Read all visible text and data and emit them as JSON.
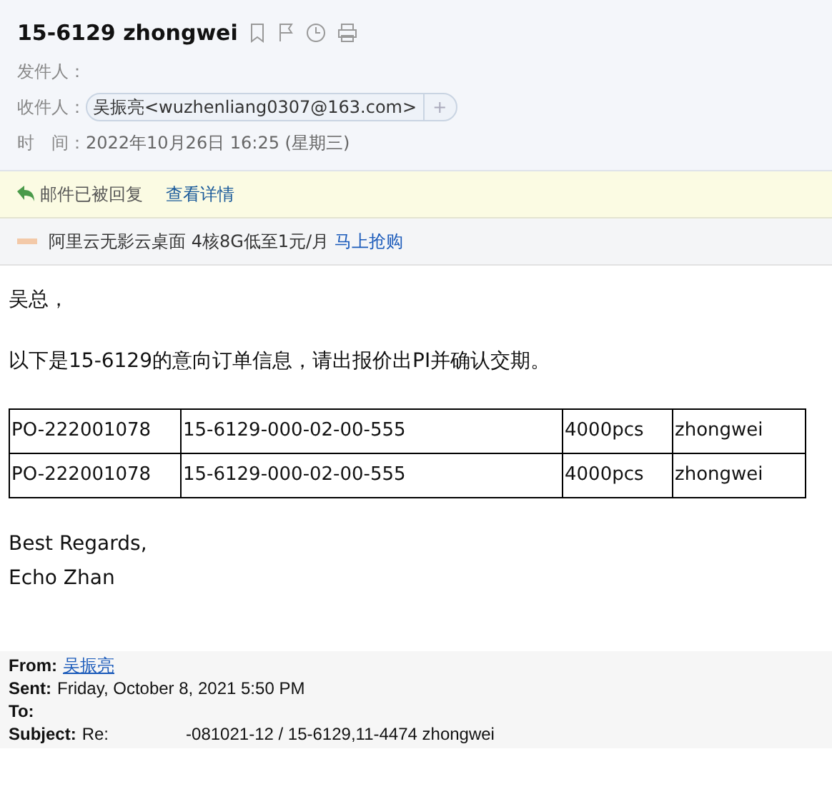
{
  "header": {
    "subject": "15-6129 zhongwei",
    "fields": [
      {
        "label": "发件人：",
        "kind": "text"
      },
      {
        "label": "收件人：",
        "kind": "chip",
        "value": "吴振亮<wuzhenliang0307@163.com>",
        "add": "+"
      },
      {
        "label": "时　间：",
        "kind": "text",
        "value": "2022年10月26日 16:25 (星期三)"
      }
    ]
  },
  "notice": {
    "text": "邮件已被回复",
    "link": "查看详情"
  },
  "ad": {
    "text": "阿里云无影云桌面 4核8G低至1元/月",
    "link": "马上抢购"
  },
  "body": {
    "greeting": "吴总，",
    "intro": "以下是15-6129的意向订单信息，请出报价出PI并确认交期。",
    "rows": [
      [
        "PO-222001078",
        "15-6129-000-02-00-555",
        "4000pcs",
        "zhongwei"
      ],
      [
        "PO-222001078",
        "15-6129-000-02-00-555",
        "4000pcs",
        "zhongwei"
      ]
    ],
    "closing": [
      "Best Regards,",
      "Echo Zhan"
    ]
  },
  "quoted": [
    {
      "label": "From:",
      "value": "吴振亮",
      "kind": "link"
    },
    {
      "label": "Sent:",
      "value": "Friday, October 8, 2021 5:50 PM",
      "kind": "text"
    },
    {
      "label": "To:",
      "kind": "text"
    },
    {
      "label": "Subject:",
      "value": "Re:",
      "value2": "-081021-12 / 15-6129,11-4474 zhongwei",
      "kind": "split"
    }
  ]
}
